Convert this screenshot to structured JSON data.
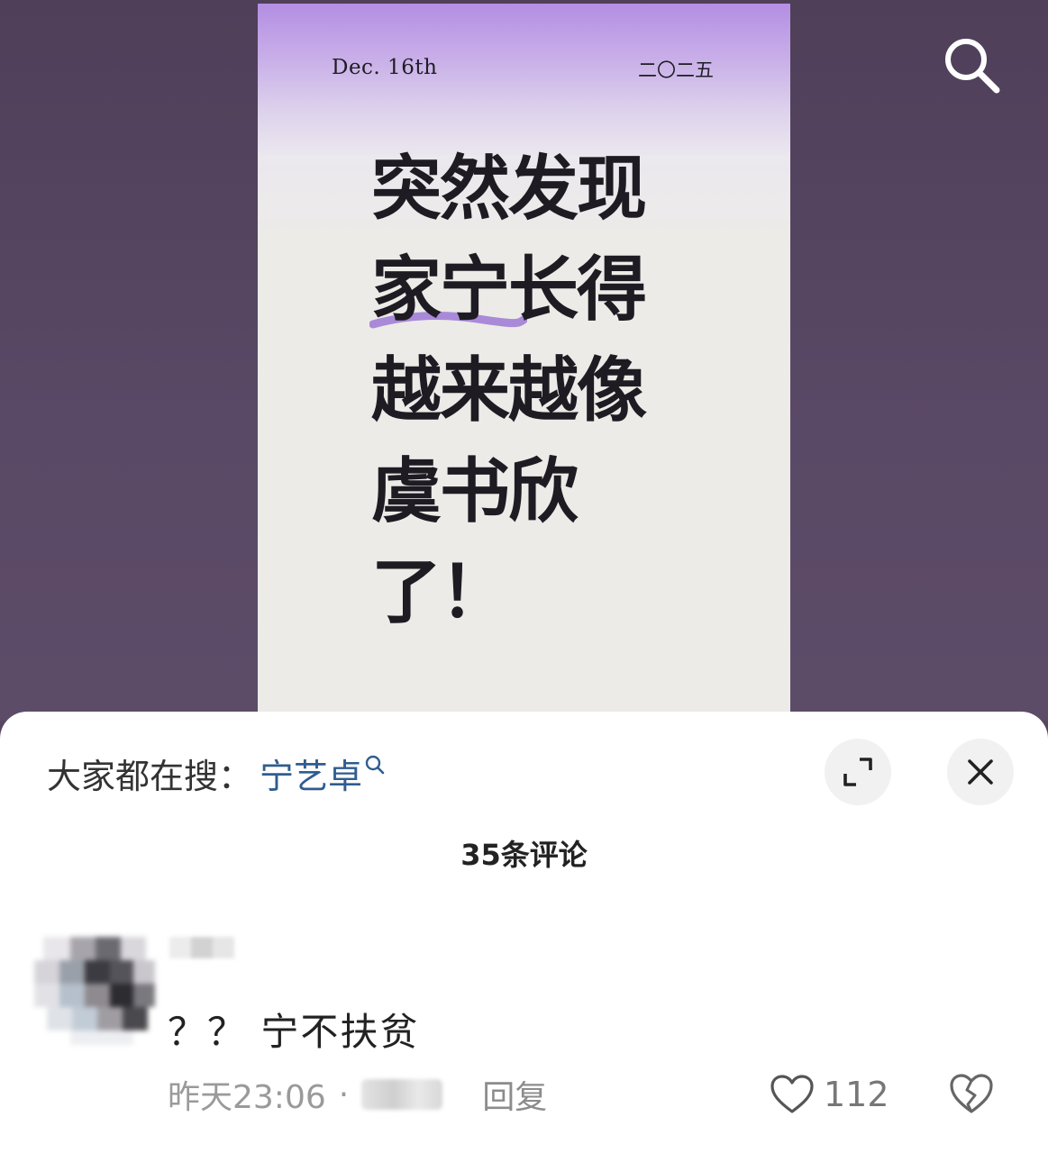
{
  "post": {
    "date": "Dec. 16th",
    "year": "二〇二五",
    "headline_lines": [
      "突然发现",
      "家宁长得",
      "越来越像",
      "虞书欣",
      "了！"
    ]
  },
  "trending": {
    "label": "大家都在搜：",
    "keyword": "宁艺卓"
  },
  "comments": {
    "count_label": "35条评论",
    "items": [
      {
        "text": "？？ 宁不扶贫",
        "time": "昨天23:06",
        "separator": "·",
        "reply_label": "回复",
        "likes": "112"
      }
    ]
  },
  "icons": {
    "search": "search-icon",
    "expand": "expand-icon",
    "close": "close-icon",
    "like": "heart-icon",
    "dislike": "broken-heart-icon"
  },
  "colors": {
    "backdrop": "#574661",
    "keyword": "#2f5d8f",
    "highlight_stroke": "#a98ad8"
  }
}
